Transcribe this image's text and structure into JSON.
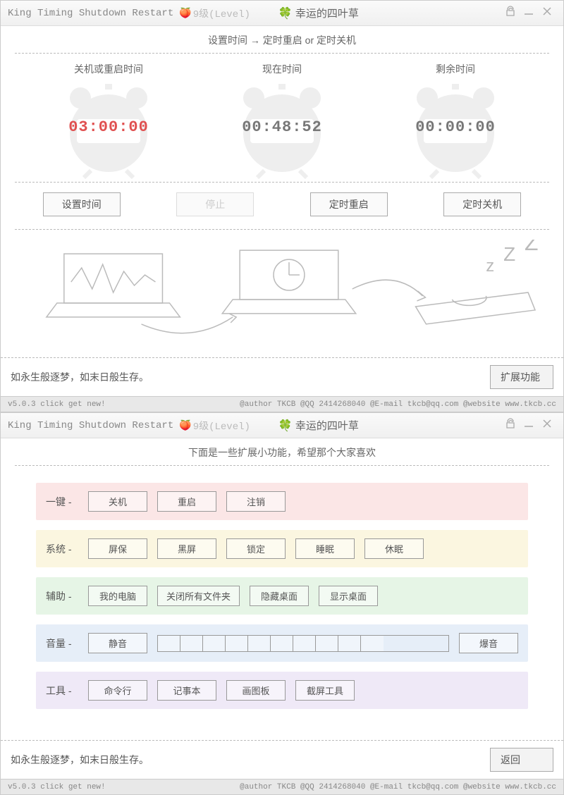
{
  "titlebar": {
    "main": "King Timing Shutdown Restart",
    "level": "9级(Level)",
    "lucky": "幸运的四叶草"
  },
  "win1": {
    "instruction": "设置时间 → 定时重启 or 定时关机",
    "clocks": {
      "shutdown_label": "关机或重启时间",
      "shutdown_time": "03:00:00",
      "now_label": "现在时间",
      "now_time": "00:48:52",
      "remain_label": "剩余时间",
      "remain_time": "00:00:00"
    },
    "buttons": {
      "set_time": "设置时间",
      "stop": "停止",
      "restart": "定时重启",
      "shutdown": "定时关机"
    },
    "motto": "如永生般逐梦，如末日般生存。",
    "expand_btn": "扩展功能"
  },
  "win2": {
    "instruction": "下面是一些扩展小功能，希望那个大家喜欢",
    "rows": {
      "onekey": {
        "label": "一键 -",
        "btns": [
          "关机",
          "重启",
          "注销"
        ]
      },
      "system": {
        "label": "系统 -",
        "btns": [
          "屏保",
          "黑屏",
          "锁定",
          "睡眠",
          "休眠"
        ]
      },
      "assist": {
        "label": "辅助 -",
        "btns": [
          "我的电脑",
          "关闭所有文件夹",
          "隐藏桌面",
          "显示桌面"
        ]
      },
      "volume": {
        "label": "音量 -",
        "mute": "静音",
        "max": "爆音"
      },
      "tools": {
        "label": "工具 -",
        "btns": [
          "命令行",
          "记事本",
          "画图板",
          "截屏工具"
        ]
      }
    },
    "motto": "如永生般逐梦，如末日般生存。",
    "back_btn": "返回"
  },
  "status": {
    "left": "v5.0.3  click get new!",
    "right": "@author TKCB  @QQ 2414268040  @E-mail tkcb@qq.com  @website www.tkcb.cc"
  }
}
